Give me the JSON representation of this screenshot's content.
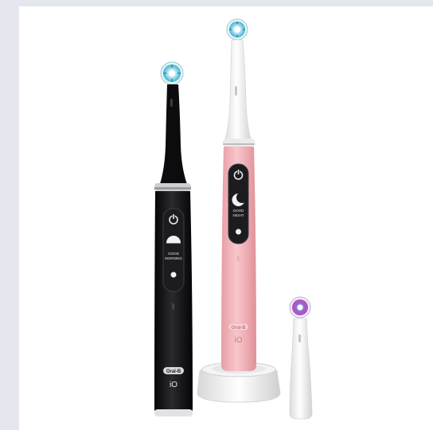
{
  "image": {
    "subject": "electric-toothbrush-product-photo",
    "background_color": "#ffffff",
    "frame_color": "#e4e8ee"
  },
  "brush_black": {
    "body_color": "#121214",
    "display_text_line1": "GOOD",
    "display_text_line2": "MORNING",
    "brand": "Oral-B",
    "model": "iO"
  },
  "brush_pink": {
    "body_color": "#f4b9bf",
    "display_text_line1": "GOOD",
    "display_text_line2": "NIGHT",
    "brand": "Oral-B",
    "model": "iO"
  },
  "refill_head": {
    "color": "#ffffff",
    "bristle_colors": [
      "#4b5bd1",
      "#d64aa6"
    ]
  },
  "icons": [
    "power-icon",
    "moon-icon",
    "sun-icon",
    "bluetooth-icon"
  ]
}
